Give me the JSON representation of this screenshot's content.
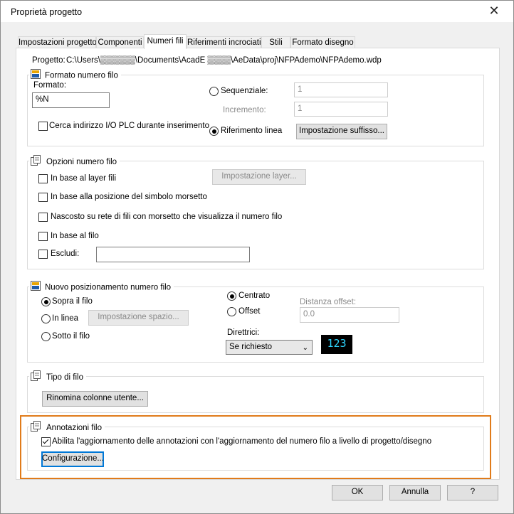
{
  "window": {
    "title": "Proprietà progetto",
    "close_label": "✕"
  },
  "tabs": [
    {
      "label": "Impostazioni progetto"
    },
    {
      "label": "Componenti"
    },
    {
      "label": "Numeri fili"
    },
    {
      "label": "Riferimenti incrociati"
    },
    {
      "label": "Stili"
    },
    {
      "label": "Formato disegno"
    }
  ],
  "project": {
    "label": "Progetto:",
    "path": "C:\\Users\\▒▒▒▒▒▒\\Documents\\AcadE ▒▒▒▒\\AeData\\proj\\NFPAdemo\\NFPAdemo.wdp"
  },
  "wire_format": {
    "title": "Formato numero filo",
    "format_label": "Formato:",
    "format_value": "%N",
    "sequential_label": "Sequenziale:",
    "sequential_value": "1",
    "increment_label": "Incremento:",
    "increment_value": "1",
    "plc_label": "Cerca indirizzo I/O PLC durante inserimento",
    "line_ref_label": "Riferimento linea",
    "suffix_button": "Impostazione suffisso..."
  },
  "wire_options": {
    "title": "Opzioni numero filo",
    "layer_label": "In base al layer fili",
    "layer_button": "Impostazione layer...",
    "terminal_label": "In base alla posizione del simbolo morsetto",
    "hidden_label": "Nascosto su rete di fili con morsetto che visualizza il numero filo",
    "wire_label": "In base al filo",
    "exclude_label": "Escludi:",
    "exclude_value": ""
  },
  "placement": {
    "title": "Nuovo posizionamento numero filo",
    "above_label": "Sopra il filo",
    "inline_label": "In linea",
    "spacing_button": "Impostazione spazio...",
    "below_label": "Sotto il filo",
    "centered_label": "Centrato",
    "offset_label": "Offset",
    "offset_distance_label": "Distanza offset:",
    "offset_distance_value": "0.0",
    "leaders_label": "Direttrici:",
    "leaders_value": "Se richiesto",
    "preview_text": "123"
  },
  "wire_type": {
    "title": "Tipo di filo",
    "rename_button": "Rinomina colonne utente..."
  },
  "annotations": {
    "title": "Annotazioni filo",
    "enable_label": "Abilita l'aggiornamento delle annotazioni con l'aggiornamento del numero filo a livello di progetto/disegno",
    "config_button": "Configurazione..."
  },
  "footer": {
    "ok": "OK",
    "cancel": "Annulla",
    "help": "?"
  },
  "colors": {
    "highlight": "#e07b1a",
    "preview_text": "#2ed6ff",
    "focus": "#0078d7"
  }
}
